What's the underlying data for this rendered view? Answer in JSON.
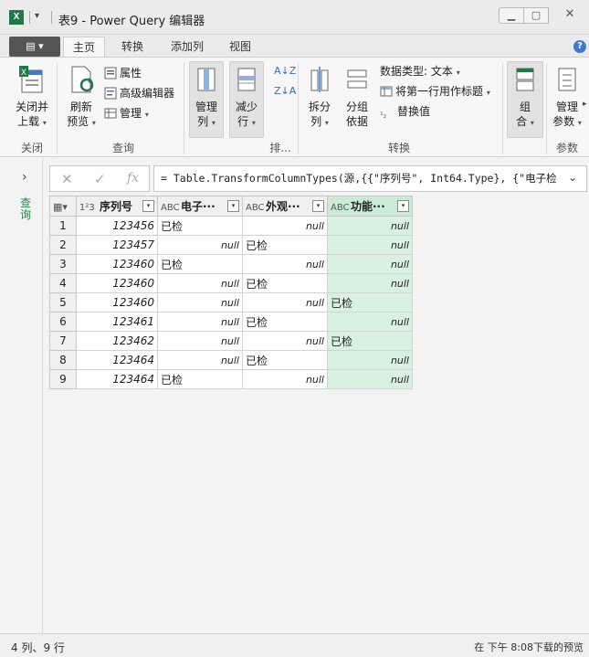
{
  "window": {
    "title": "表9 - Power Query 编辑器",
    "app_icon": "X"
  },
  "tabs": [
    {
      "label": "主页",
      "active": true
    },
    {
      "label": "转换",
      "active": false
    },
    {
      "label": "添加列",
      "active": false
    },
    {
      "label": "视图",
      "active": false
    }
  ],
  "ribbon": {
    "close_load": {
      "line1": "关闭并",
      "line2": "上载"
    },
    "refresh": {
      "line1": "刷新",
      "line2": "预览"
    },
    "properties": "属性",
    "advanced_editor": "高级编辑器",
    "manage": "管理",
    "manage_columns": {
      "line1": "管理",
      "line2": "列"
    },
    "reduce_rows": {
      "line1": "减少",
      "line2": "行"
    },
    "split_column": {
      "line1": "拆分",
      "line2": "列"
    },
    "group_by": {
      "line1": "分组",
      "line2": "依据"
    },
    "data_type": "数据类型: 文本",
    "first_row_header": "将第一行用作标题",
    "replace_values": "替换值",
    "combine": {
      "line1": "组",
      "line2": "合"
    },
    "manage_params": {
      "line1": "管理",
      "line2": "参数"
    },
    "groups": {
      "close": "关闭",
      "query": "查询",
      "sort": "排...",
      "transform": "转换",
      "params": "参数"
    }
  },
  "navigator": {
    "label": "查询"
  },
  "formula": "= Table.TransformColumnTypes(源,{{\"序列号\", Int64.Type}, {\"电子检",
  "table": {
    "columns": [
      {
        "type": "1²3",
        "name": "序列号"
      },
      {
        "type": "ABC",
        "name": "电子···"
      },
      {
        "type": "ABC",
        "name": "外观···"
      },
      {
        "type": "ABC",
        "name": "功能···"
      }
    ],
    "rows": [
      {
        "n": "1",
        "c1": "123456",
        "c2": "已检",
        "c3": "null",
        "c4": "null"
      },
      {
        "n": "2",
        "c1": "123457",
        "c2": "null",
        "c3": "已检",
        "c4": "null"
      },
      {
        "n": "3",
        "c1": "123460",
        "c2": "已检",
        "c3": "null",
        "c4": "null"
      },
      {
        "n": "4",
        "c1": "123460",
        "c2": "null",
        "c3": "已检",
        "c4": "null"
      },
      {
        "n": "5",
        "c1": "123460",
        "c2": "null",
        "c3": "null",
        "c4": "已检"
      },
      {
        "n": "6",
        "c1": "123461",
        "c2": "null",
        "c3": "已检",
        "c4": "null"
      },
      {
        "n": "7",
        "c1": "123462",
        "c2": "null",
        "c3": "null",
        "c4": "已检"
      },
      {
        "n": "8",
        "c1": "123464",
        "c2": "null",
        "c3": "已检",
        "c4": "null"
      },
      {
        "n": "9",
        "c1": "123464",
        "c2": "已检",
        "c3": "null",
        "c4": "null"
      }
    ]
  },
  "status": {
    "left": "4 列、9 行",
    "right": "在 下午 8:08下载的预览"
  },
  "colors": {
    "selected_column": "#d8f1e1",
    "nav_label": "#1e8a43",
    "excel_green": "#1f7a45"
  }
}
